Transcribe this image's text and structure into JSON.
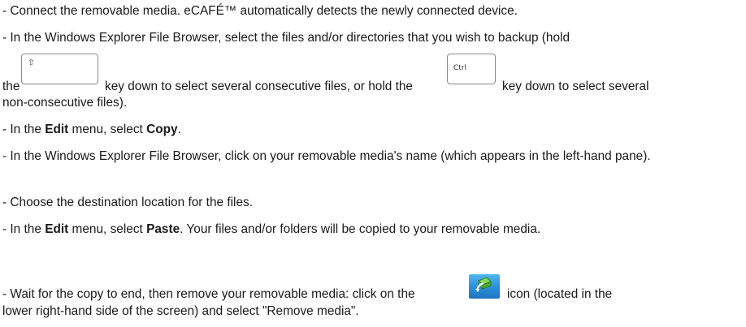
{
  "steps": {
    "s1": "- Connect the removable media. eCAFÉ™ automatically detects the newly connected device.",
    "s2_line1": "- In the Windows Explorer File Browser, select the files and/or directories that you wish to backup (hold",
    "s2_the": "the",
    "s2_mid": "key down to select several consecutive files, or hold the",
    "s2_end": "key down to select several",
    "s2_line3": "non-consecutive files).",
    "s3_pre": "- In the ",
    "s3_menu": "Edit",
    "s3_mid": " menu, select ",
    "s3_cmd": "Copy",
    "s3_post": ".",
    "s4": "- In the Windows Explorer File Browser, click on your removable media's name (which appears in the left-hand pane).",
    "s5": "- Choose the destination location for the files.",
    "s6_pre": "- In the ",
    "s6_menu": "Edit",
    "s6_mid": " menu, select ",
    "s6_cmd": "Paste",
    "s6_post": ". Your files and/or folders will be copied to your removable media.",
    "s7_pre": "- Wait for the copy to end, then remove your removable media: click on the",
    "s7_post": "icon (located in the",
    "s7_line2": "lower right-hand side of the screen) and select \"Remove media\"."
  },
  "keys": {
    "shift_glyph": "⇧",
    "ctrl_glyph": "Ctrl"
  },
  "icons": {
    "shift_key": "shift-key-icon",
    "ctrl_key": "ctrl-key-icon",
    "remove_media": "remove-media-tray-icon"
  },
  "colors": {
    "tray_icon": "#2a8fd6"
  }
}
